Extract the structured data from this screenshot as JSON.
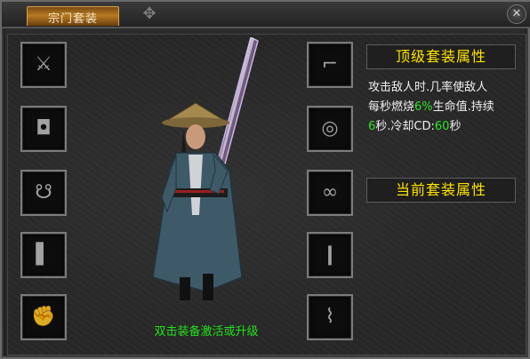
{
  "window": {
    "title": "宗门套装",
    "close_icon": "close-icon"
  },
  "left_slots": [
    "bracer-icon",
    "helmet-icon",
    "necklace-icon",
    "boots-icon",
    "gauntlet-icon"
  ],
  "right_slots": [
    "belt-icon",
    "ring-icon",
    "earring-icon",
    "leg-icon",
    "armband-icon"
  ],
  "hint": "双击装备激活或升级",
  "top_set": {
    "title": "顶级套装属性",
    "line1": "攻击敌人时.几率使敌人",
    "line2_prefix": "每秒燃烧",
    "line2_pct": "6%",
    "line2_suffix": "生命值.持续",
    "line3_sec": "6",
    "line3_mid": "秒.冷却CD:",
    "line3_cd": "60",
    "line3_suffix": "秒"
  },
  "current_set": {
    "title": "当前套装属性"
  },
  "colors": {
    "accent_yellow": "#ffe400",
    "green": "#2fe526"
  }
}
